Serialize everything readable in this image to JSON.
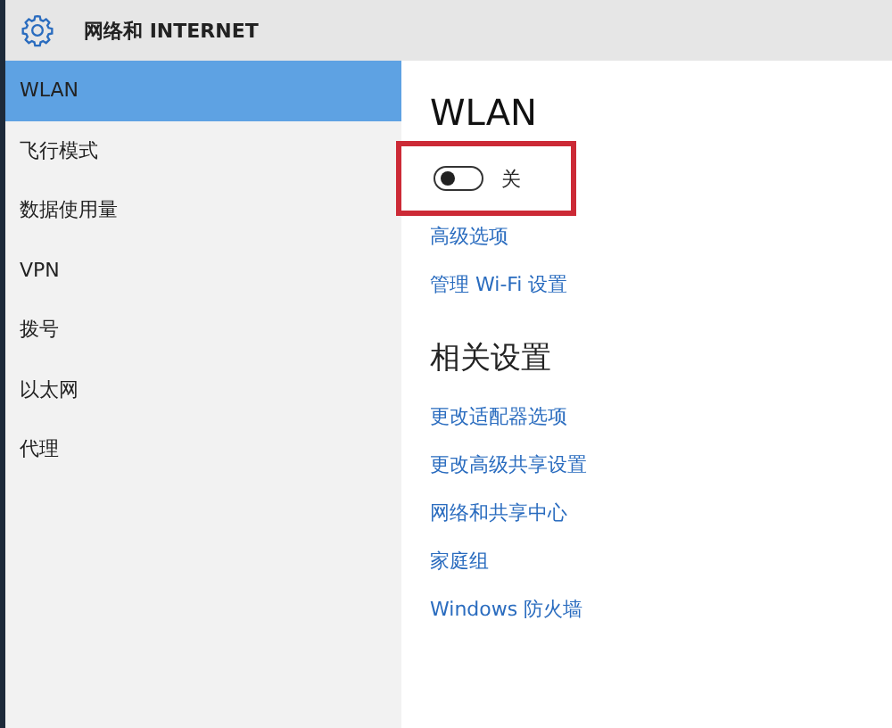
{
  "header": {
    "title": "网络和 INTERNET"
  },
  "sidebar": {
    "items": [
      {
        "label": "WLAN",
        "selected": true
      },
      {
        "label": "飞行模式",
        "selected": false
      },
      {
        "label": "数据使用量",
        "selected": false
      },
      {
        "label": "VPN",
        "selected": false
      },
      {
        "label": "拨号",
        "selected": false
      },
      {
        "label": "以太网",
        "selected": false
      },
      {
        "label": "代理",
        "selected": false
      }
    ]
  },
  "content": {
    "title": "WLAN",
    "toggle": {
      "on": false,
      "label": "关",
      "highlighted": true
    },
    "links": [
      "高级选项",
      "管理 Wi-Fi 设置"
    ],
    "related": {
      "title": "相关设置",
      "links": [
        "更改适配器选项",
        "更改高级共享设置",
        "网络和共享中心",
        "家庭组",
        "Windows 防火墙"
      ]
    }
  }
}
